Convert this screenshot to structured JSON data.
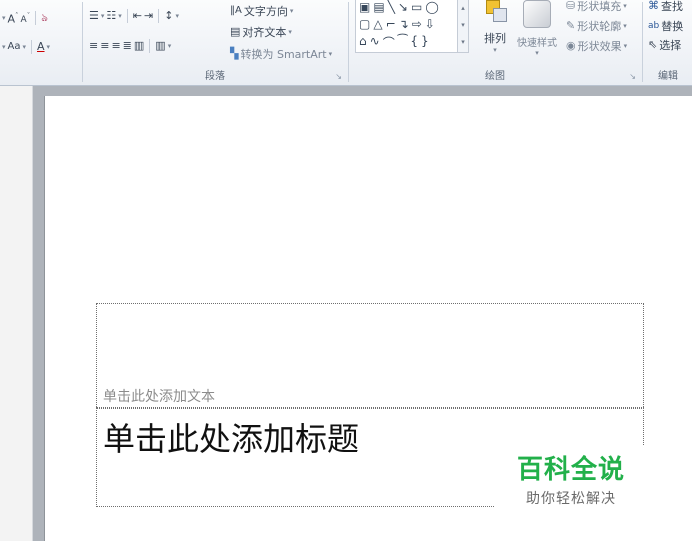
{
  "ribbon": {
    "font_group": {
      "grow_font": "A",
      "shrink_font": "A",
      "clear_format": "ঌ",
      "change_case": "Aa",
      "font_color": "A"
    },
    "paragraph_group": {
      "label": "段落",
      "text_direction": "文字方向",
      "align_text": "对齐文本",
      "convert_smartart": "转换为 SmartArt"
    },
    "drawing_group": {
      "label": "绘图",
      "arrange": "排列",
      "quick_styles": "快速样式",
      "shape_fill": "形状填充",
      "shape_outline": "形状轮廓",
      "shape_effects": "形状效果"
    },
    "editing_group": {
      "label": "编辑",
      "find": "查找",
      "replace": "替换",
      "select": "选择"
    }
  },
  "slide": {
    "text_placeholder": "单击此处添加文本",
    "title_placeholder": "单击此处添加标题"
  },
  "watermark": {
    "title": "百科全说",
    "subtitle": "助你轻松解决"
  },
  "colors": {
    "watermark_green": "#22b04a",
    "ribbon_bg": "#e9edf3",
    "workspace_bg": "#aeb3ba"
  }
}
